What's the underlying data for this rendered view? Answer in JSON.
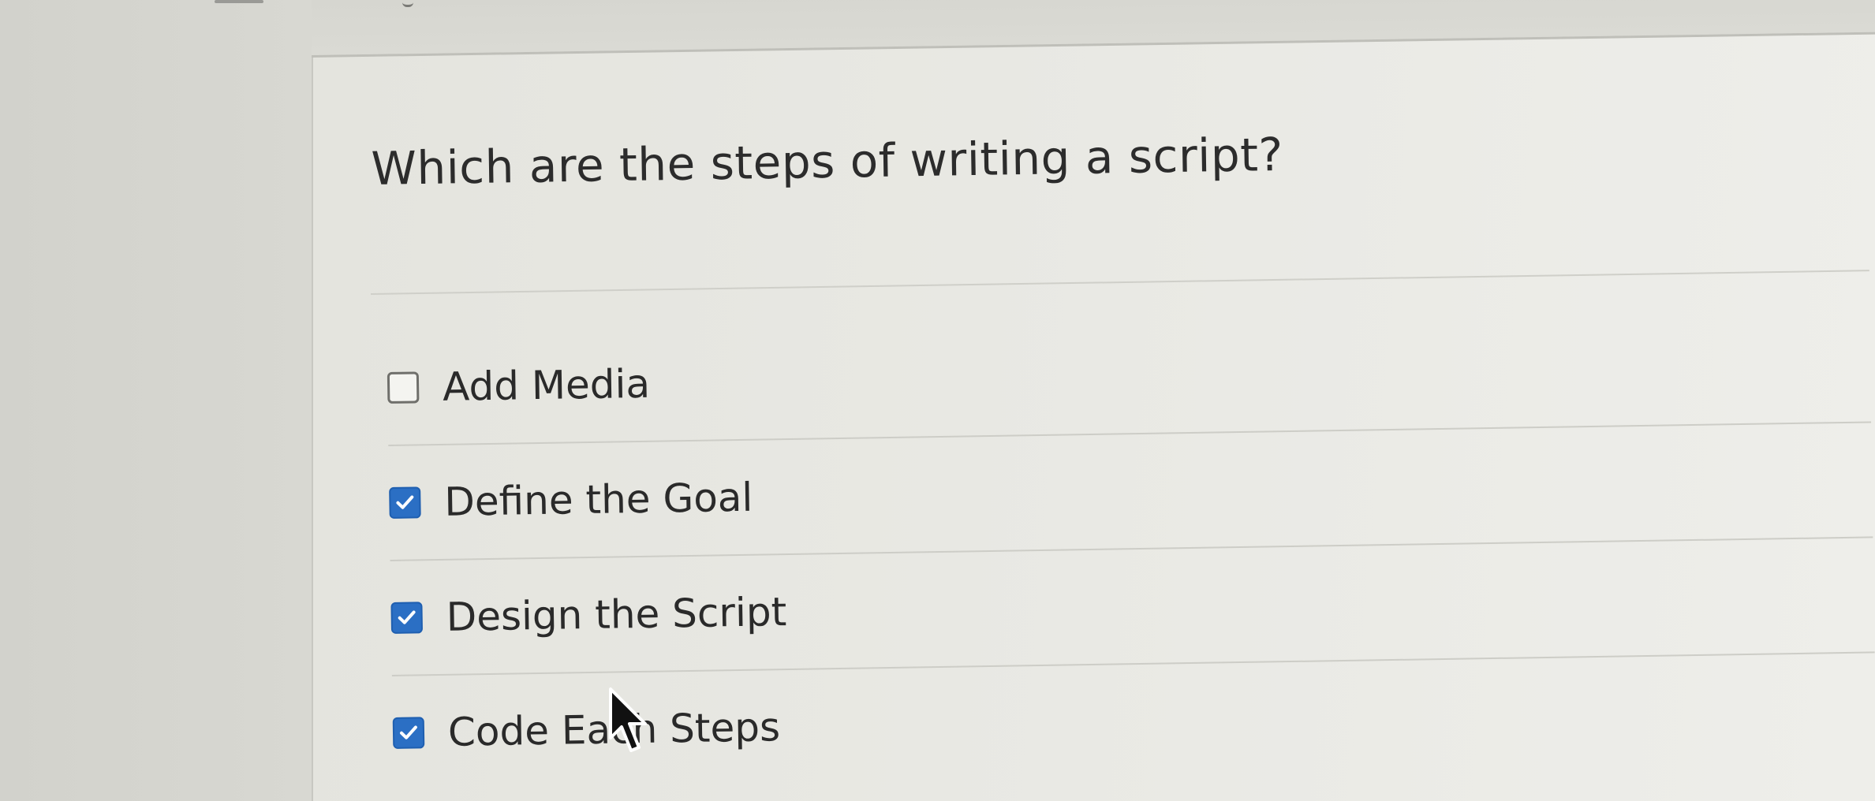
{
  "question": {
    "text": "Which are the steps of writing a script?"
  },
  "answers": [
    {
      "label": "Add Media",
      "checked": false
    },
    {
      "label": "Define the Goal",
      "checked": true
    },
    {
      "label": "Design the Script",
      "checked": true
    },
    {
      "label": "Code Each Steps",
      "checked": true
    }
  ],
  "colors": {
    "checkbox_checked": "#2b6fc4",
    "text": "#2a2a2a",
    "background": "#e8e8e3"
  },
  "icons": {
    "checkmark": "check-icon",
    "cursor": "arrow-cursor-icon"
  }
}
